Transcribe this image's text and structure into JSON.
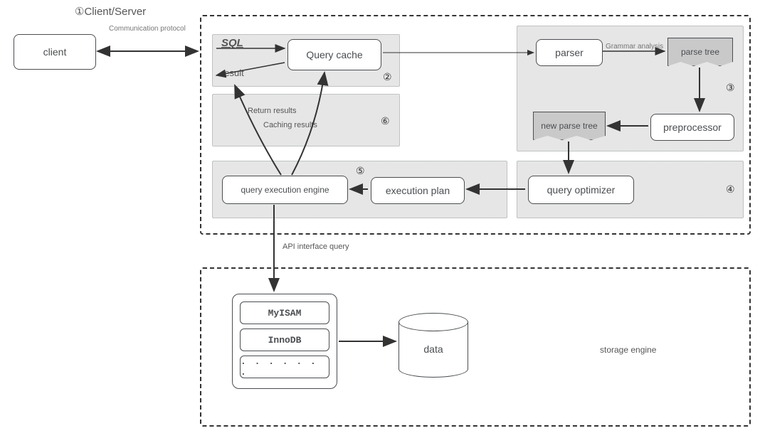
{
  "header": {
    "title": "Client/Server",
    "numbered_prefix": "①"
  },
  "boxes": {
    "client": "client",
    "query_cache": "Query cache",
    "parser": "parser",
    "preprocessor": "preprocessor",
    "query_optimizer": "query optimizer",
    "execution_plan": "execution plan",
    "query_exec_engine": "query execution engine",
    "parse_tree": "parse tree",
    "new_parse_tree": "new parse tree"
  },
  "labels": {
    "comm_protocol": "Communication protocol",
    "sql": "SQL",
    "result": "result",
    "grammar": "Grammar analysis",
    "return_results": "Return results",
    "caching_results": "Caching results",
    "api_query": "API interface query",
    "storage_engine": "storage engine",
    "data": "data"
  },
  "numbers": {
    "n2": "②",
    "n3": "③",
    "n4": "④",
    "n5": "⑤",
    "n6": "⑥"
  },
  "engines": {
    "myisam": "MyISAM",
    "innodb": "InnoDB",
    "more": ". . . . . . ."
  }
}
